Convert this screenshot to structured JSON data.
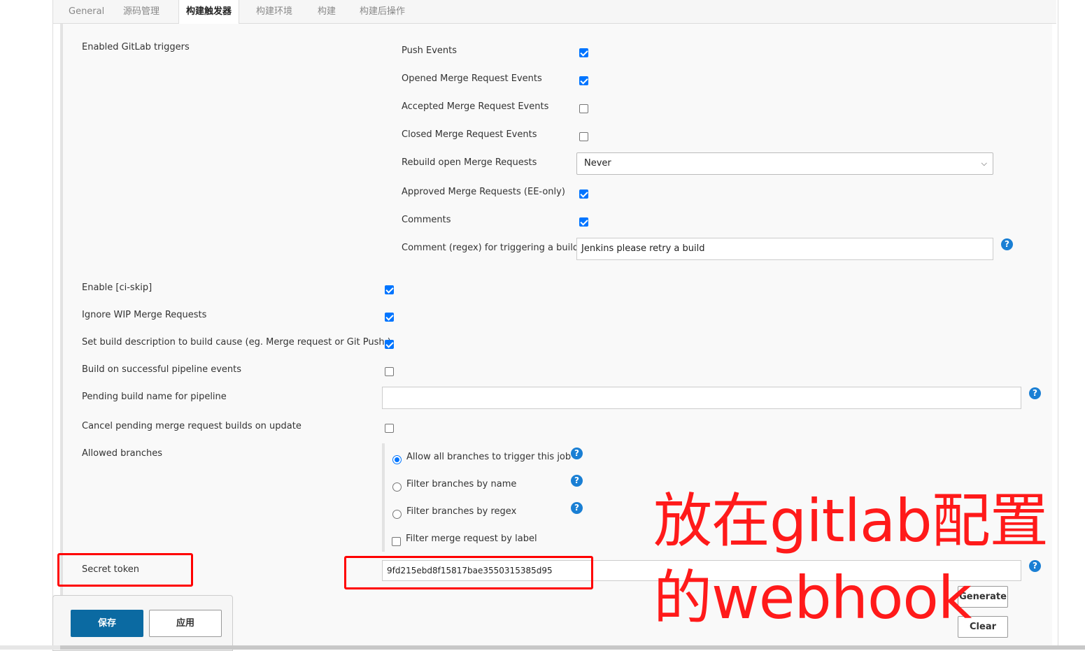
{
  "tabs": [
    "General",
    "源码管理",
    "构建触发器",
    "构建环境",
    "构建",
    "构建后操作"
  ],
  "active_tab": "构建触发器",
  "gitlab_triggers": {
    "label": "Enabled GitLab triggers",
    "push_events": {
      "label": "Push Events",
      "checked": true
    },
    "opened_mr": {
      "label": "Opened Merge Request Events",
      "checked": true
    },
    "accepted_mr": {
      "label": "Accepted Merge Request Events",
      "checked": false
    },
    "closed_mr": {
      "label": "Closed Merge Request Events",
      "checked": false
    },
    "rebuild_open_mr": {
      "label": "Rebuild open Merge Requests",
      "value": "Never"
    },
    "approved_mr": {
      "label": "Approved Merge Requests (EE-only)",
      "checked": true
    },
    "comments": {
      "label": "Comments",
      "checked": true
    },
    "comment_regex": {
      "label": "Comment (regex) for triggering a build",
      "value": "Jenkins please retry a build"
    }
  },
  "options": {
    "ci_skip": {
      "label": "Enable [ci-skip]",
      "checked": true
    },
    "ignore_wip": {
      "label": "Ignore WIP Merge Requests",
      "checked": true
    },
    "set_description": {
      "label": "Set build description to build cause (eg. Merge request or Git Push )",
      "checked": true
    },
    "pipeline_events": {
      "label": "Build on successful pipeline events",
      "checked": false
    },
    "pending_build_name": {
      "label": "Pending build name for pipeline",
      "value": ""
    },
    "cancel_pending": {
      "label": "Cancel pending merge request builds on update",
      "checked": false
    }
  },
  "allowed_branches": {
    "label": "Allowed branches",
    "all": "Allow all branches to trigger this job",
    "by_name": "Filter branches by name",
    "by_regex": "Filter branches by regex",
    "by_label": "Filter merge request by label"
  },
  "secret_token": {
    "label": "Secret token",
    "value": "9fd215ebd8f15817bae3550315385d95",
    "generate_label": "Generate",
    "clear_label": "Clear"
  },
  "footer": {
    "save_label": "保存",
    "apply_label": "应用"
  },
  "annotation": {
    "line1": "放在gitlab配置",
    "line2": "的webhook",
    "color": "#ff0000"
  },
  "help_glyph": "?"
}
